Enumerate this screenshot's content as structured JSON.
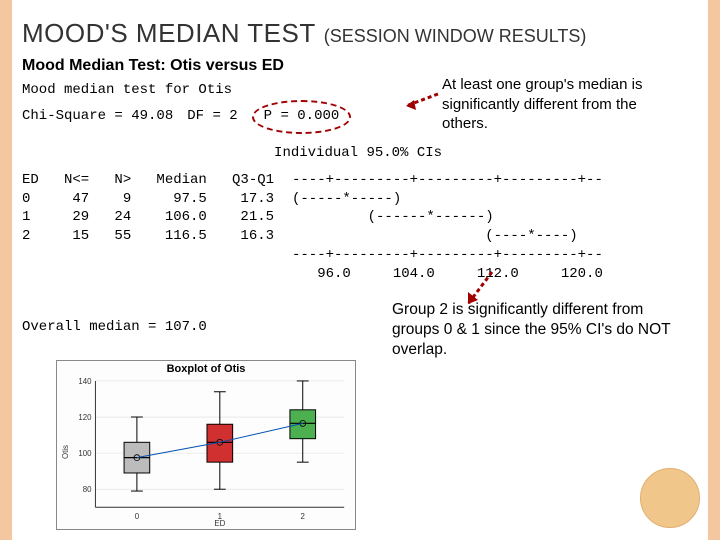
{
  "title": {
    "main": "MOOD'S MEDIAN TEST",
    "sub": "(SESSION WINDOW RESULTS)"
  },
  "mood_title": "Mood Median Test: Otis versus ED",
  "stats": {
    "line1": "Mood median test for Otis",
    "chi_label": "Chi-Square = 49.08",
    "df_label": "DF = 2",
    "p_label": "P = 0.000"
  },
  "annotation1": "At least one group's median is significantly different from the others.",
  "annotation2": "Group 2 is significantly different from groups 0 & 1 since the 95% CI's do NOT overlap.",
  "ci_header": "                              Individual 95.0% CIs",
  "table_header": "ED   N<=   N>   Median   Q3-Q1",
  "table_rows": [
    "0     47    9     97.5    17.3",
    "1     29   24    106.0    21.5",
    "2     15   55    116.5    16.3"
  ],
  "ci_rows": [
    "----+---------+---------+---------+--",
    "(-----*-----)",
    "         (------*------)",
    "                       (----*----)",
    "----+---------+---------+---------+--"
  ],
  "ci_axis": "   96.0     104.0     112.0     120.0",
  "overall": "Overall median = 107.0",
  "boxplot_title": "Boxplot of Otis",
  "chart_data": {
    "type": "boxplot",
    "title": "Boxplot of Otis",
    "xlabel": "ED",
    "ylabel": "Otis",
    "categories": [
      "0",
      "1",
      "2"
    ],
    "series": [
      {
        "name": "0",
        "min": 79,
        "q1": 89,
        "median": 97.5,
        "q3": 106,
        "max": 120,
        "color": "#bcbcbc"
      },
      {
        "name": "1",
        "min": 80,
        "q1": 95,
        "median": 106.0,
        "q3": 116,
        "max": 134,
        "color": "#d03030"
      },
      {
        "name": "2",
        "min": 95,
        "q1": 108,
        "median": 116.5,
        "q3": 124,
        "max": 140,
        "color": "#4caf50"
      }
    ],
    "ylim": [
      70,
      140
    ]
  }
}
